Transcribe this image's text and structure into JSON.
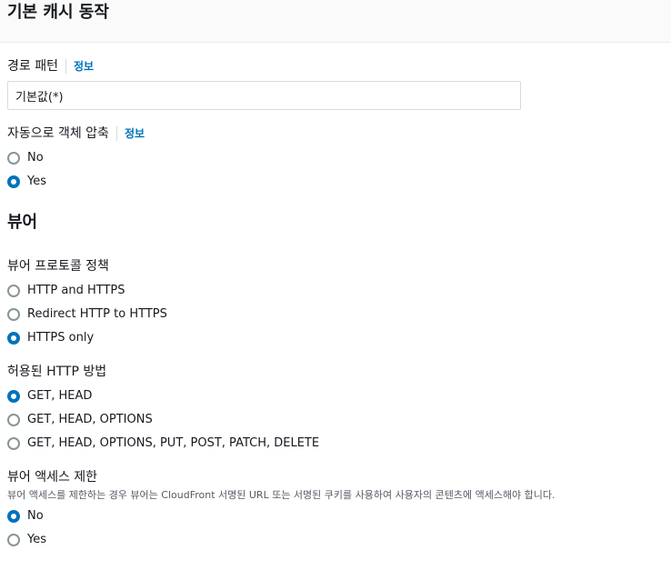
{
  "default_cache": {
    "title": "기본 캐시 동작",
    "path_pattern": {
      "label": "경로 패턴",
      "info": "정보",
      "value": "기본값(*)"
    },
    "compress": {
      "label": "자동으로 객체 압축",
      "info": "정보",
      "options": [
        {
          "label": "No",
          "checked": false
        },
        {
          "label": "Yes",
          "checked": true
        }
      ]
    }
  },
  "viewer": {
    "title": "뷰어",
    "protocol_policy": {
      "label": "뷰어 프로토콜 정책",
      "options": [
        {
          "label": "HTTP and HTTPS",
          "checked": false
        },
        {
          "label": "Redirect HTTP to HTTPS",
          "checked": false
        },
        {
          "label": "HTTPS only",
          "checked": true
        }
      ]
    },
    "allowed_methods": {
      "label": "허용된 HTTP 방법",
      "options": [
        {
          "label": "GET, HEAD",
          "checked": true
        },
        {
          "label": "GET, HEAD, OPTIONS",
          "checked": false
        },
        {
          "label": "GET, HEAD, OPTIONS, PUT, POST, PATCH, DELETE",
          "checked": false
        }
      ]
    },
    "restrict_access": {
      "label": "뷰어 액세스 제한",
      "description": "뷰어 액세스를 제한하는 경우 뷰어는 CloudFront 서명된 URL 또는 서명된 쿠키를 사용하여 사용자의 콘텐츠에 액세스해야 합니다.",
      "options": [
        {
          "label": "No",
          "checked": true
        },
        {
          "label": "Yes",
          "checked": false
        }
      ]
    }
  },
  "colors": {
    "accent": "#0073bb",
    "text": "#16191f",
    "muted": "#545b64",
    "border": "#d5dbdb"
  }
}
